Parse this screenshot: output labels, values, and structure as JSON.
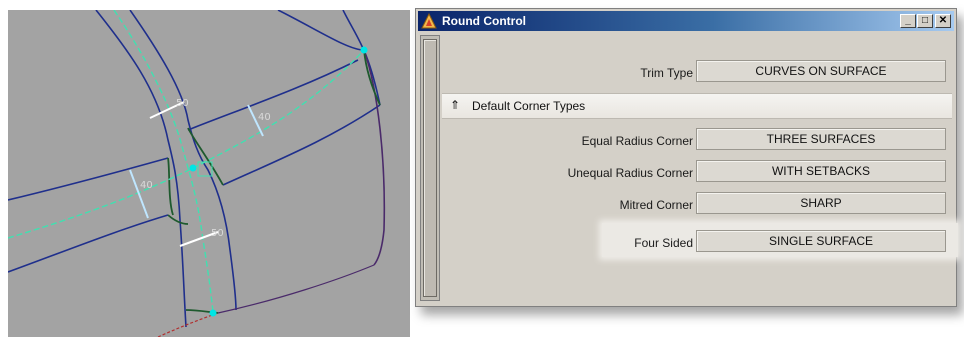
{
  "window": {
    "title": "Round Control",
    "buttons": {
      "minimize": "_",
      "maximize": "□",
      "close": "✕"
    }
  },
  "trim_type": {
    "label": "Trim Type",
    "value": "CURVES ON SURFACE"
  },
  "section": {
    "label": "Default Corner Types",
    "icon": "collapse-arrow-icon"
  },
  "corners": [
    {
      "label": "Equal Radius Corner",
      "value": "THREE SURFACES"
    },
    {
      "label": "Unequal Radius Corner",
      "value": "WITH SETBACKS"
    },
    {
      "label": "Mitred Corner",
      "value": "SHARP"
    },
    {
      "label": "Four Sided",
      "value": "SINGLE SURFACE"
    }
  ],
  "colors": {
    "title_bar": "#0a246a",
    "viewport_bg": "#a3a3a3",
    "surface_edge": "#1f2f8c",
    "center_curve": "#40e0b0",
    "cyan_point": "#00e5e5"
  }
}
